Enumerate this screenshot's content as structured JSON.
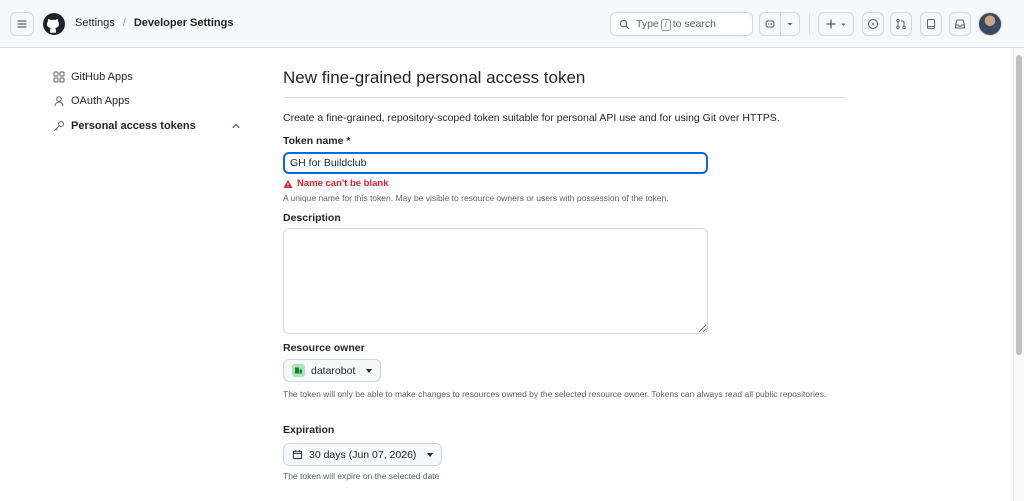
{
  "header": {
    "breadcrumb": [
      "Settings",
      "Developer Settings"
    ],
    "search_placeholder_pre": "Type",
    "search_kbd": "/",
    "search_placeholder_post": "to search"
  },
  "sidebar": {
    "items": [
      {
        "label": "GitHub Apps",
        "icon": "apps-icon"
      },
      {
        "label": "OAuth Apps",
        "icon": "person-icon"
      },
      {
        "label": "Personal access tokens",
        "icon": "key-icon",
        "active": true
      }
    ]
  },
  "main": {
    "title": "New fine-grained personal access token",
    "intro": "Create a fine-grained, repository-scoped token suitable for personal API use and for using Git over HTTPS.",
    "token_name": {
      "label": "Token name *",
      "value": "GH for Buildclub",
      "error": "Name can't be blank",
      "hint": "A unique name for this token. May be visible to resource owners or users with possession of the token."
    },
    "description": {
      "label": "Description",
      "value": ""
    },
    "resource_owner": {
      "label": "Resource owner",
      "selected": "datarobot",
      "hint": "The token will only be able to make changes to resources owned by the selected resource owner. Tokens can always read all public repositories."
    },
    "expiration": {
      "label": "Expiration",
      "selected": "30 days (Jun 07, 2026)",
      "hint": "The token will expire on the selected date"
    }
  },
  "colors": {
    "accent": "#0969da",
    "error": "#d1242f",
    "border": "#d0d7de",
    "muted": "#59636e"
  }
}
